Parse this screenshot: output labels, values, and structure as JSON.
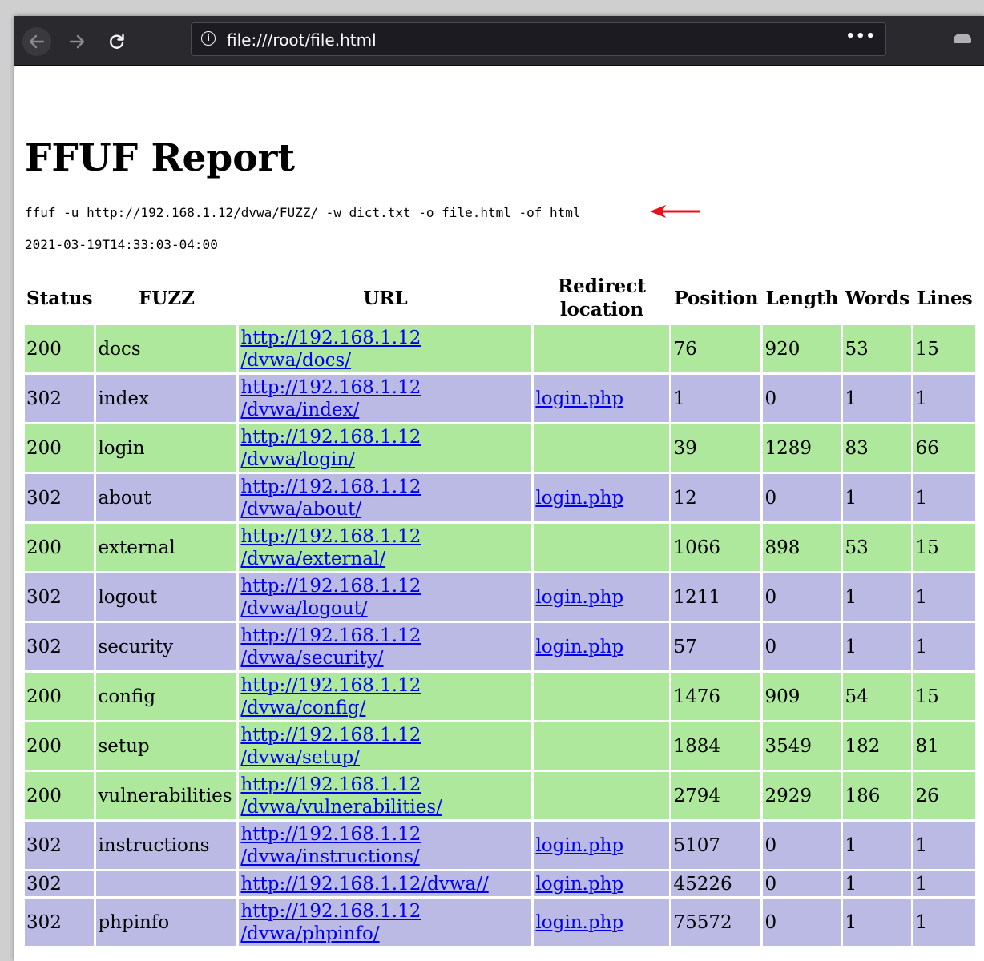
{
  "browser": {
    "url": "file:///root/file.html"
  },
  "page": {
    "title": "FFUF Report",
    "command": "ffuf -u http://192.168.1.12/dvwa/FUZZ/ -w dict.txt -o file.html -of html",
    "timestamp": "2021-03-19T14:33:03-04:00"
  },
  "table": {
    "headers": {
      "status": "Status",
      "fuzz": "FUZZ",
      "url": "URL",
      "redirect_line1": "Redirect",
      "redirect_line2": "location",
      "position": "Position",
      "length": "Length",
      "words": "Words",
      "lines": "Lines"
    },
    "rows": [
      {
        "status": "200",
        "fuzz": "docs",
        "url1": "http://192.168.1.12",
        "url2": "/dvwa/docs/",
        "redirect": "",
        "position": "76",
        "length": "920",
        "words": "53",
        "lines": "15"
      },
      {
        "status": "302",
        "fuzz": "index",
        "url1": "http://192.168.1.12",
        "url2": "/dvwa/index/",
        "redirect": "login.php",
        "position": "1",
        "length": "0",
        "words": "1",
        "lines": "1"
      },
      {
        "status": "200",
        "fuzz": "login",
        "url1": "http://192.168.1.12",
        "url2": "/dvwa/login/",
        "redirect": "",
        "position": "39",
        "length": "1289",
        "words": "83",
        "lines": "66"
      },
      {
        "status": "302",
        "fuzz": "about",
        "url1": "http://192.168.1.12",
        "url2": "/dvwa/about/",
        "redirect": "login.php",
        "position": "12",
        "length": "0",
        "words": "1",
        "lines": "1"
      },
      {
        "status": "200",
        "fuzz": "external",
        "url1": "http://192.168.1.12",
        "url2": "/dvwa/external/",
        "redirect": "",
        "position": "1066",
        "length": "898",
        "words": "53",
        "lines": "15"
      },
      {
        "status": "302",
        "fuzz": "logout",
        "url1": "http://192.168.1.12",
        "url2": "/dvwa/logout/",
        "redirect": "login.php",
        "position": "1211",
        "length": "0",
        "words": "1",
        "lines": "1"
      },
      {
        "status": "302",
        "fuzz": "security",
        "url1": "http://192.168.1.12",
        "url2": "/dvwa/security/",
        "redirect": "login.php",
        "position": "57",
        "length": "0",
        "words": "1",
        "lines": "1"
      },
      {
        "status": "200",
        "fuzz": "config",
        "url1": "http://192.168.1.12",
        "url2": "/dvwa/config/",
        "redirect": "",
        "position": "1476",
        "length": "909",
        "words": "54",
        "lines": "15"
      },
      {
        "status": "200",
        "fuzz": "setup",
        "url1": "http://192.168.1.12",
        "url2": "/dvwa/setup/",
        "redirect": "",
        "position": "1884",
        "length": "3549",
        "words": "182",
        "lines": "81"
      },
      {
        "status": "200",
        "fuzz": "vulnerabilities",
        "url1": "http://192.168.1.12",
        "url2": "/dvwa/vulnerabilities/",
        "redirect": "",
        "position": "2794",
        "length": "2929",
        "words": "186",
        "lines": "26"
      },
      {
        "status": "302",
        "fuzz": "instructions",
        "url1": "http://192.168.1.12",
        "url2": "/dvwa/instructions/",
        "redirect": "login.php",
        "position": "5107",
        "length": "0",
        "words": "1",
        "lines": "1"
      },
      {
        "status": "302",
        "fuzz": "",
        "url1": "http://192.168.1.12/dvwa//",
        "url2": "",
        "redirect": "login.php",
        "position": "45226",
        "length": "0",
        "words": "1",
        "lines": "1"
      },
      {
        "status": "302",
        "fuzz": "phpinfo",
        "url1": "http://192.168.1.12",
        "url2": "/dvwa/phpinfo/",
        "redirect": "login.php",
        "position": "75572",
        "length": "0",
        "words": "1",
        "lines": "1"
      }
    ]
  },
  "colors": {
    "status_200_row": "#aee89c",
    "status_302_row": "#babae4",
    "link": "#0000ee",
    "annotation_arrow": "#e8101a"
  }
}
